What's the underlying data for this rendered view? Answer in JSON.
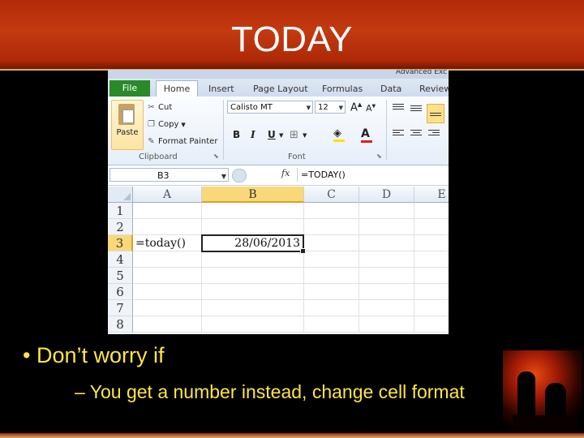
{
  "slide": {
    "title": "TODAY",
    "bullet": "• Don’t worry if",
    "sub_bullet": "– You get a number instead, change cell format"
  },
  "excel": {
    "window_title_partial": "Advanced Exc",
    "tabs": [
      "File",
      "Home",
      "Insert",
      "Page Layout",
      "Formulas",
      "Data",
      "Review"
    ],
    "clipboard": {
      "paste": "Paste",
      "cut": "Cut",
      "copy": "Copy",
      "format_painter": "Format Painter",
      "group_label": "Clipboard"
    },
    "font": {
      "name": "Calisto MT",
      "size": "12",
      "group_label": "Font"
    },
    "formula_bar": {
      "name_box": "B3",
      "fx": "fx",
      "formula": "=TODAY()"
    },
    "columns": [
      "A",
      "B",
      "C",
      "D",
      "E"
    ],
    "rows": [
      "1",
      "2",
      "3",
      "4",
      "5",
      "6",
      "7",
      "8"
    ],
    "cells": {
      "A3": "=today()",
      "B3": "28/06/2013"
    },
    "selected_cell": "B3"
  },
  "colors": {
    "title_bg": "#c33a10",
    "bullet_text": "#ffe640",
    "file_tab": "#2a8a2a",
    "selection_header": "#f8d878"
  }
}
